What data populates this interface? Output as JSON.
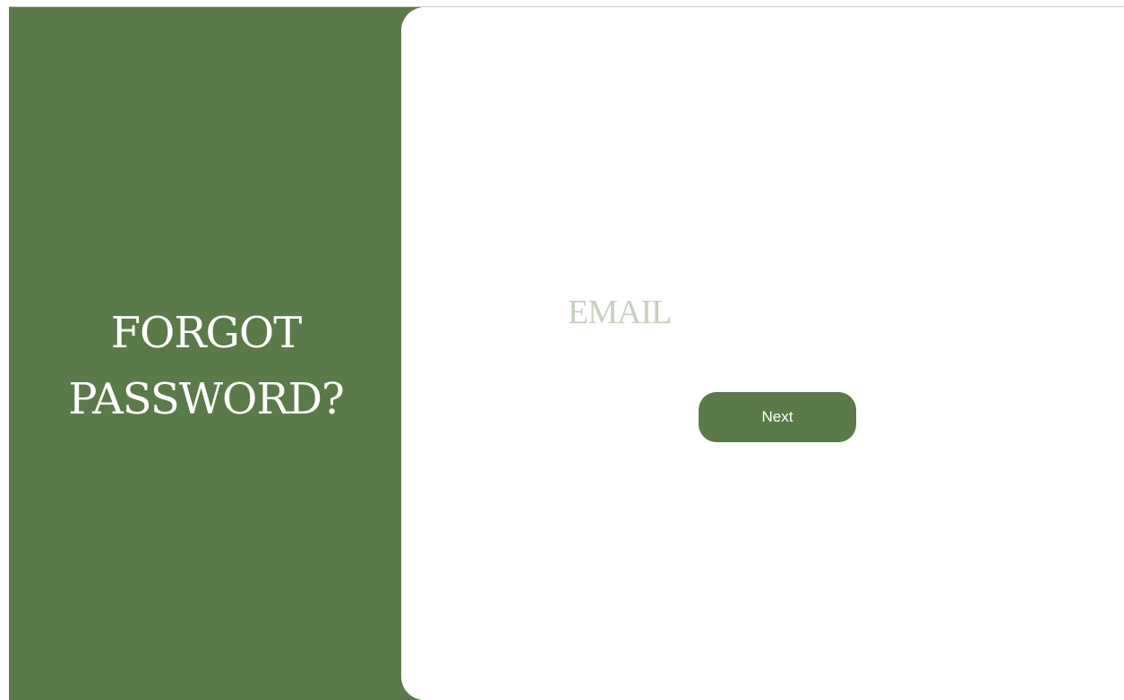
{
  "left_panel": {
    "title_line1": "FORGOT",
    "title_line2": "PASSWORD?"
  },
  "form": {
    "email_placeholder": "EMAIL",
    "email_value": "",
    "next_label": "Next"
  },
  "colors": {
    "brand_green": "#5a7a49",
    "placeholder": "#c5d0bd",
    "background": "#ffffff"
  }
}
